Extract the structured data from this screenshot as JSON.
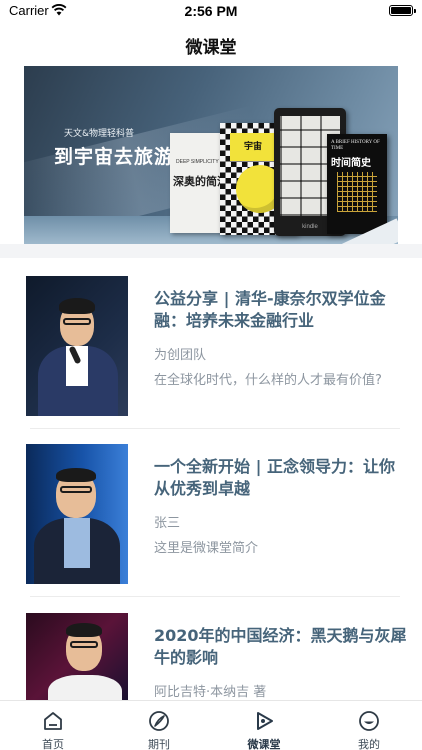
{
  "status_bar": {
    "carrier": "Carrier",
    "time": "2:56 PM"
  },
  "nav": {
    "title": "微课堂"
  },
  "banner": {
    "subtitle": "天文&物理轻科普",
    "headline": "到宇宙去旅游",
    "books": {
      "white_en": "DEEP SIMPLICITY",
      "white_cn": "深奥的简洁",
      "check_label": "宇宙",
      "kindle_brand": "kindle",
      "black_en": "A BRIEF HISTORY OF TIME",
      "black_cn": "时间简史"
    }
  },
  "courses": [
    {
      "title": "公益分享 | 清华-康奈尔双学位金融：培养未来金融行业",
      "author": "为创团队",
      "desc": "在全球化时代，什么样的人才最有价值?"
    },
    {
      "title": "一个全新开始 | 正念领导力：让你从优秀到卓越",
      "author": "张三",
      "desc": "这里是微课堂简介"
    },
    {
      "title": "2020年的中国经济：黑天鹅与灰犀牛的影响",
      "author": "阿比吉特·本纳吉 著",
      "desc": ""
    }
  ],
  "tabbar": [
    {
      "label": "首页",
      "icon": "home-icon",
      "active": false
    },
    {
      "label": "期刊",
      "icon": "journal-icon",
      "active": false
    },
    {
      "label": "微课堂",
      "icon": "play-icon",
      "active": true
    },
    {
      "label": "我的",
      "icon": "profile-icon",
      "active": false
    }
  ],
  "colors": {
    "title": "#46647a",
    "meta": "#8d96a0",
    "separator": "#ececec",
    "band": "#f3f4f6"
  }
}
